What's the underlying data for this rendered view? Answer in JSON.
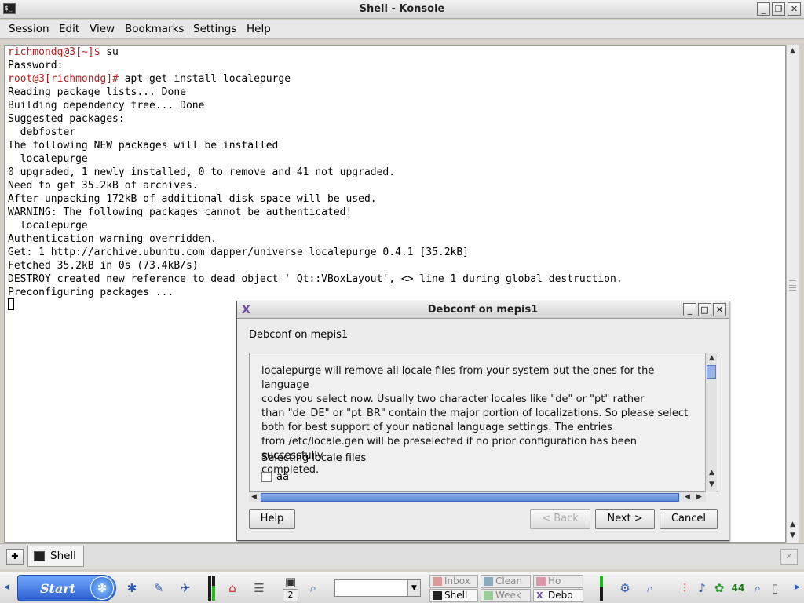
{
  "window": {
    "title": "Shell - Konsole",
    "app_icon": "terminal-icon",
    "minimize_icon": "minimize-icon",
    "maximize_icon": "maximize-icon",
    "close_icon": "close-icon"
  },
  "menu": {
    "session": "Session",
    "edit": "Edit",
    "view": "View",
    "bookmarks": "Bookmarks",
    "settings": "Settings",
    "help": "Help"
  },
  "terminal": {
    "lines": [
      {
        "prompt": "richmondg@3[~]$ ",
        "text": "su"
      },
      {
        "prompt": "",
        "text": "Password:"
      },
      {
        "prompt": "root@3[richmondg]# ",
        "text": "apt-get install localepurge"
      },
      {
        "prompt": "",
        "text": "Reading package lists... Done"
      },
      {
        "prompt": "",
        "text": "Building dependency tree... Done"
      },
      {
        "prompt": "",
        "text": "Suggested packages:"
      },
      {
        "prompt": "",
        "text": "  debfoster"
      },
      {
        "prompt": "",
        "text": "The following NEW packages will be installed"
      },
      {
        "prompt": "",
        "text": "  localepurge"
      },
      {
        "prompt": "",
        "text": "0 upgraded, 1 newly installed, 0 to remove and 41 not upgraded."
      },
      {
        "prompt": "",
        "text": "Need to get 35.2kB of archives."
      },
      {
        "prompt": "",
        "text": "After unpacking 172kB of additional disk space will be used."
      },
      {
        "prompt": "",
        "text": "WARNING: The following packages cannot be authenticated!"
      },
      {
        "prompt": "",
        "text": "  localepurge"
      },
      {
        "prompt": "",
        "text": "Authentication warning overridden."
      },
      {
        "prompt": "",
        "text": "Get: 1 http://archive.ubuntu.com dapper/universe localepurge 0.4.1 [35.2kB]"
      },
      {
        "prompt": "",
        "text": "Fetched 35.2kB in 0s (73.4kB/s)"
      },
      {
        "prompt": "",
        "text": "DESTROY created new reference to dead object ' Qt::VBoxLayout', <> line 1 during global destruction."
      },
      {
        "prompt": "",
        "text": "Preconfiguring packages ..."
      }
    ]
  },
  "tabs": {
    "active_label": "Shell",
    "new_tab_icon": "new-session-icon",
    "close_tab_icon": "close-session-icon"
  },
  "dialog": {
    "title": "Debconf on mepis1",
    "heading": "Debconf on mepis1",
    "description": [
      "localepurge will remove all locale files from your system but the ones for the language",
      "codes you select now. Usually two character locales like \"de\" or \"pt\" rather",
      "than \"de_DE\" or \"pt_BR\" contain the major portion of localizations. So please select",
      "both for best support of your national language settings.  The entries",
      "from /etc/locale.gen will be preselected if no prior configuration has been successfully",
      "completed."
    ],
    "select_label": "Selecting locale files",
    "checkbox_label": "aa",
    "buttons": {
      "help": "Help",
      "back": "< Back",
      "next": "Next >",
      "cancel": "Cancel"
    }
  },
  "taskbar": {
    "start_label": "Start",
    "desktop_number": "2",
    "tasks": [
      {
        "label": "Inbox",
        "active": false
      },
      {
        "label": "Clean",
        "active": false
      },
      {
        "label": "Ho",
        "active": false
      },
      {
        "label": "Shell",
        "active": true
      },
      {
        "label": "Week",
        "active": false
      },
      {
        "label": "Debo",
        "active": true
      }
    ],
    "tray_number": "44"
  },
  "colors": {
    "prompt": "#b22222",
    "accent_blue": "#5b85d8"
  }
}
